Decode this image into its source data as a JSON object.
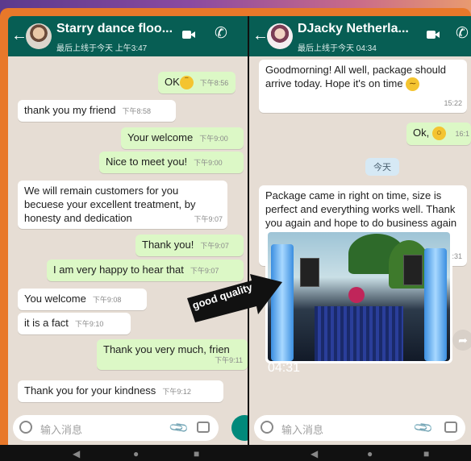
{
  "left_chat": {
    "name": "Starry dance floo...",
    "status": "最后上线于今天 上午3:47",
    "messages": [
      {
        "dir": "out",
        "text": "OK",
        "emoji": "grinning-face",
        "time": "下午8:56"
      },
      {
        "dir": "in",
        "text": "thank you my friend",
        "time": "下午8:58"
      },
      {
        "dir": "out",
        "text": "Your welcome",
        "time": "下午9:00"
      },
      {
        "dir": "out",
        "text": "Nice to meet you!",
        "time": "下午9:00"
      },
      {
        "dir": "in",
        "text": "We will remain customers for you becuese your excellent treatment, by honesty and dedication",
        "time": "下午9:07"
      },
      {
        "dir": "out",
        "text": "Thank you!",
        "time": "下午9:07"
      },
      {
        "dir": "out",
        "text": "I am very happy to hear that",
        "time": "下午9:07"
      },
      {
        "dir": "in",
        "text": "You welcome",
        "time": "下午9:08"
      },
      {
        "dir": "in",
        "text": "it is a fact",
        "time": "下午9:10"
      },
      {
        "dir": "out",
        "text": "Thank you very much, frien",
        "time": "下午9:11"
      },
      {
        "dir": "in",
        "text": "Thank you for your kindness",
        "time": "下午9:12"
      }
    ],
    "input_placeholder": "输入消息"
  },
  "right_chat": {
    "name": "DJacky Netherla...",
    "status": "最后上线于今天 04:34",
    "messages": [
      {
        "dir": "in",
        "text": "Goodmorning! All well, package should arrive today. Hope it's on time",
        "emoji": "confused-face",
        "time": "15:22"
      },
      {
        "dir": "out",
        "text": "Ok,",
        "emoji": "ok-hand",
        "time": "16:1"
      },
      {
        "dir": "day",
        "text": "今天"
      },
      {
        "dir": "in",
        "text": "Package came in right on time, size is perfect and everything works well. Thank you again and hope to do business again soon! Just not for a led curtain",
        "emoji": "squinting-tongue-face",
        "time": "04:31"
      },
      {
        "dir": "in",
        "type": "photo",
        "time": "04:31"
      }
    ],
    "input_placeholder": "输入消息"
  },
  "overlay": {
    "text": "good quality"
  },
  "colors": {
    "header": "#075e54",
    "outgoing": "#dcf8c6",
    "incoming": "#ffffff",
    "chat_bg": "#e6ddd4",
    "frame": "#e8782a",
    "send_button": "#00897b"
  }
}
